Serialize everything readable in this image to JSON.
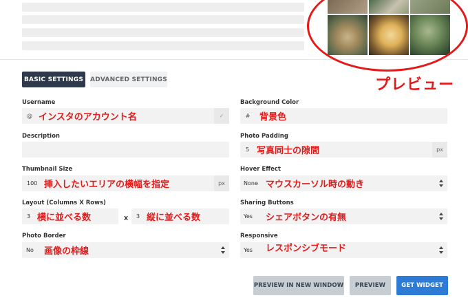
{
  "preview_annotation": "プレビュー",
  "tabs": {
    "basic": "BASIC SETTINGS",
    "advanced": "ADVANCED SETTINGS"
  },
  "fields": {
    "username": {
      "label": "Username",
      "prefix": "@",
      "annotation": "インスタのアカウント名",
      "check": "✓"
    },
    "description": {
      "label": "Description"
    },
    "thumbnail_size": {
      "label": "Thumbnail Size",
      "value": "100",
      "suffix": "px",
      "annotation": "挿入したいエリアの横幅を指定"
    },
    "layout": {
      "label": "Layout (Columns X Rows)",
      "columns": "3",
      "rows": "3",
      "times": "X",
      "columns_annotation": "横に並べる数",
      "rows_annotation": "縦に並べる数"
    },
    "photo_border": {
      "label": "Photo Border",
      "value": "No",
      "annotation": "画像の枠線"
    },
    "background_color": {
      "label": "Background Color",
      "prefix": "#",
      "annotation": "背景色"
    },
    "photo_padding": {
      "label": "Photo Padding",
      "value": "5",
      "suffix": "px",
      "annotation": "写真同士の隙間"
    },
    "hover_effect": {
      "label": "Hover Effect",
      "value": "None",
      "annotation": "マウスカーソル時の動き"
    },
    "sharing_buttons": {
      "label": "Sharing Buttons",
      "value": "Yes",
      "annotation": "シェアボタンの有無"
    },
    "responsive": {
      "label": "Responsive",
      "value": "Yes",
      "annotation": "レスポンシブモード"
    }
  },
  "buttons": {
    "preview_new_window": "PREVIEW IN NEW WINDOW",
    "preview": "PREVIEW",
    "get_widget": "GET WIDGET"
  },
  "colors": {
    "annotation_red": "#e41a1a",
    "tab_active": "#2e3a4c",
    "primary_button": "#2e7bd6",
    "secondary_button": "#c6cdd3"
  }
}
